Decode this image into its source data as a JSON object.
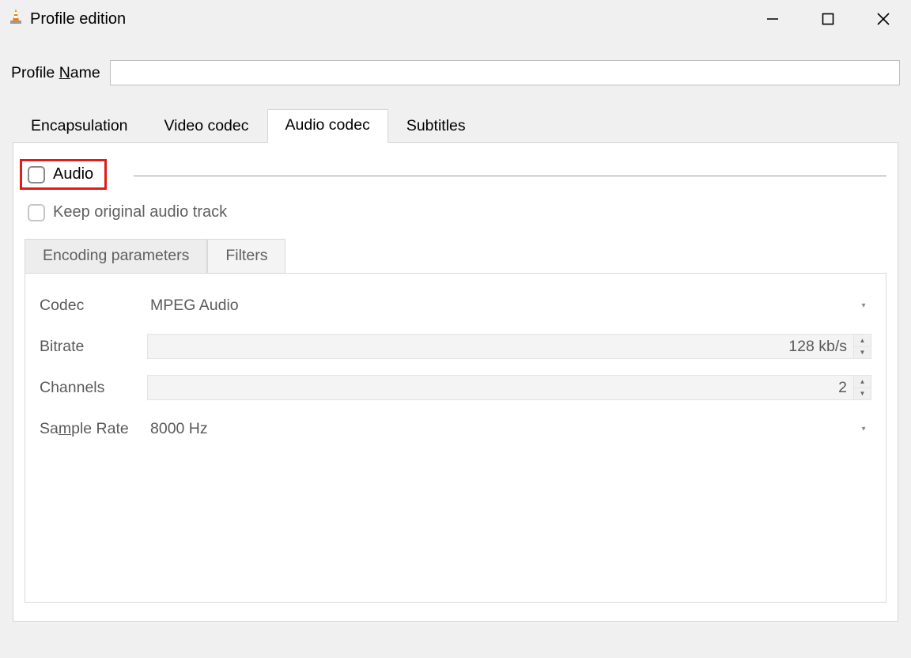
{
  "window": {
    "title": "Profile edition"
  },
  "profile": {
    "label_pre": "Profile ",
    "label_access": "N",
    "label_post": "ame",
    "value": ""
  },
  "tabs": {
    "encapsulation": "Encapsulation",
    "video_codec": "Video codec",
    "audio_codec": "Audio codec",
    "subtitles": "Subtitles"
  },
  "audio": {
    "group_label": "Audio",
    "keep_label": "Keep original audio track",
    "subtabs": {
      "encoding": "Encoding parameters",
      "filters": "Filters"
    },
    "params": {
      "codec_label": "Codec",
      "codec_value": "MPEG Audio",
      "bitrate_label": "Bitrate",
      "bitrate_value": "128 kb/s",
      "channels_label": "Channels",
      "channels_value": "2",
      "samplerate_label_pre": "Sa",
      "samplerate_label_access": "m",
      "samplerate_label_post": "ple Rate",
      "samplerate_value": "8000 Hz"
    }
  }
}
